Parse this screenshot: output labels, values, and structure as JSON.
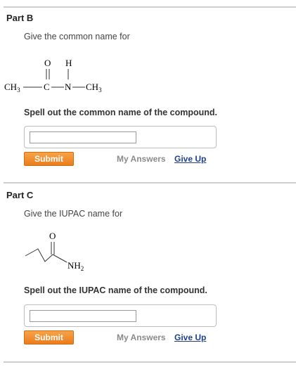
{
  "parts": [
    {
      "title": "Part B",
      "prompt": "Give the common name for",
      "instruction": "Spell out the common name of the compound.",
      "answer_value": "",
      "submit_label": "Submit",
      "my_answers_label": "My Answers",
      "give_up_label": "Give Up",
      "structure": {
        "top_O": "O",
        "top_H": "H",
        "ch3_left": "CH",
        "ch3_left_sub": "3",
        "carbon": "C",
        "nitrogen": "N",
        "ch3_right": "CH",
        "ch3_right_sub": "3"
      }
    },
    {
      "title": "Part C",
      "prompt": "Give the IUPAC name for",
      "instruction": "Spell out the IUPAC name of the compound.",
      "answer_value": "",
      "submit_label": "Submit",
      "my_answers_label": "My Answers",
      "give_up_label": "Give Up",
      "structure": {
        "oxygen": "O",
        "amine": "NH",
        "amine_sub": "2"
      }
    }
  ],
  "colors": {
    "submit_button": "#ea7d1d",
    "give_up_link": "#1f3f8e",
    "my_answers_text": "#8a8a8a",
    "divider": "#cfcfcf"
  }
}
